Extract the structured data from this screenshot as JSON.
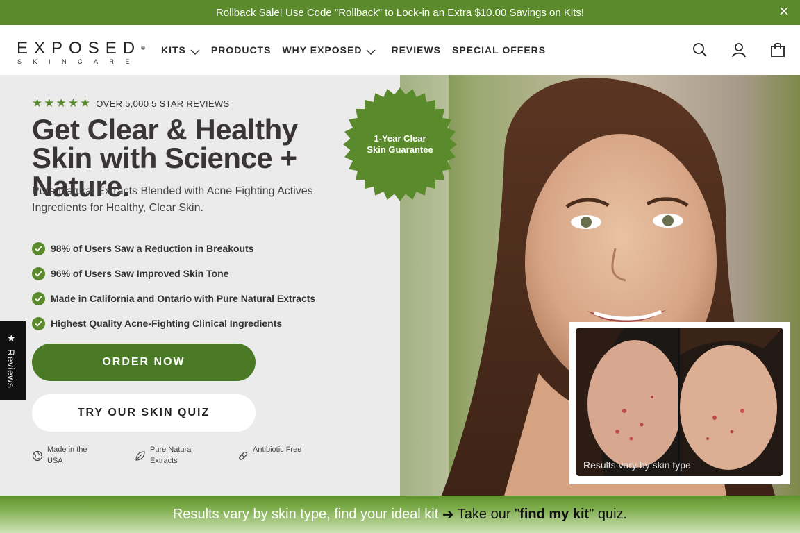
{
  "announcement": {
    "text": "Rollback Sale! Use Code \"Rollback\" to Lock-in an Extra $10.00 Savings on Kits!",
    "close_icon": "close-icon"
  },
  "logo": {
    "main": "EXPOSED",
    "mark": "®",
    "sub": "SKINCARE"
  },
  "nav": {
    "items": [
      {
        "label": "KITS",
        "has_dropdown": true
      },
      {
        "label": "PRODUCTS",
        "has_dropdown": false
      },
      {
        "label": "WHY EXPOSED",
        "has_dropdown": true
      },
      {
        "label": "REVIEWS",
        "has_dropdown": false
      },
      {
        "label": "SPECIAL OFFERS",
        "has_dropdown": false
      }
    ],
    "icons": [
      "search-icon",
      "account-icon",
      "cart-icon"
    ]
  },
  "hero": {
    "rating_stars": 5,
    "rating_text": "OVER 5,000 5 STAR REVIEWS",
    "title": "Get Clear & Healthy Skin with Science + Nature.",
    "subtitle": "Pure Natural Extracts Blended with Acne Fighting Actives Ingredients for Healthy, Clear Skin.",
    "checks": [
      "98% of Users Saw a Reduction in Breakouts",
      "96% of Users Saw Improved Skin Tone",
      "Made in California and Ontario with Pure Natural Extracts",
      "Highest Quality Acne-Fighting Clinical Ingredients"
    ],
    "order_button": "ORDER NOW",
    "quiz_button": "TRY OUR SKIN QUIZ",
    "badges": [
      {
        "icon": "globe-icon",
        "label": "Made in the USA"
      },
      {
        "icon": "leaf-icon",
        "label": "Pure Natural Extracts"
      },
      {
        "icon": "pill-icon",
        "label": "Antibiotic Free"
      }
    ],
    "seal_text": "1-Year Clear Skin Guarantee",
    "inset_caption": "Results vary by skin type"
  },
  "reviews_tab": {
    "label": "Reviews"
  },
  "bottom_bar": {
    "part1": "Results vary by skin type, find your ideal kit ",
    "arrow": "➔",
    "part2": " Take our \"",
    "link": "find my kit",
    "part3": "\" quiz."
  },
  "colors": {
    "brand_green": "#5a8a2b",
    "button_green": "#4b7a26",
    "hero_bg": "#ebebeb"
  }
}
